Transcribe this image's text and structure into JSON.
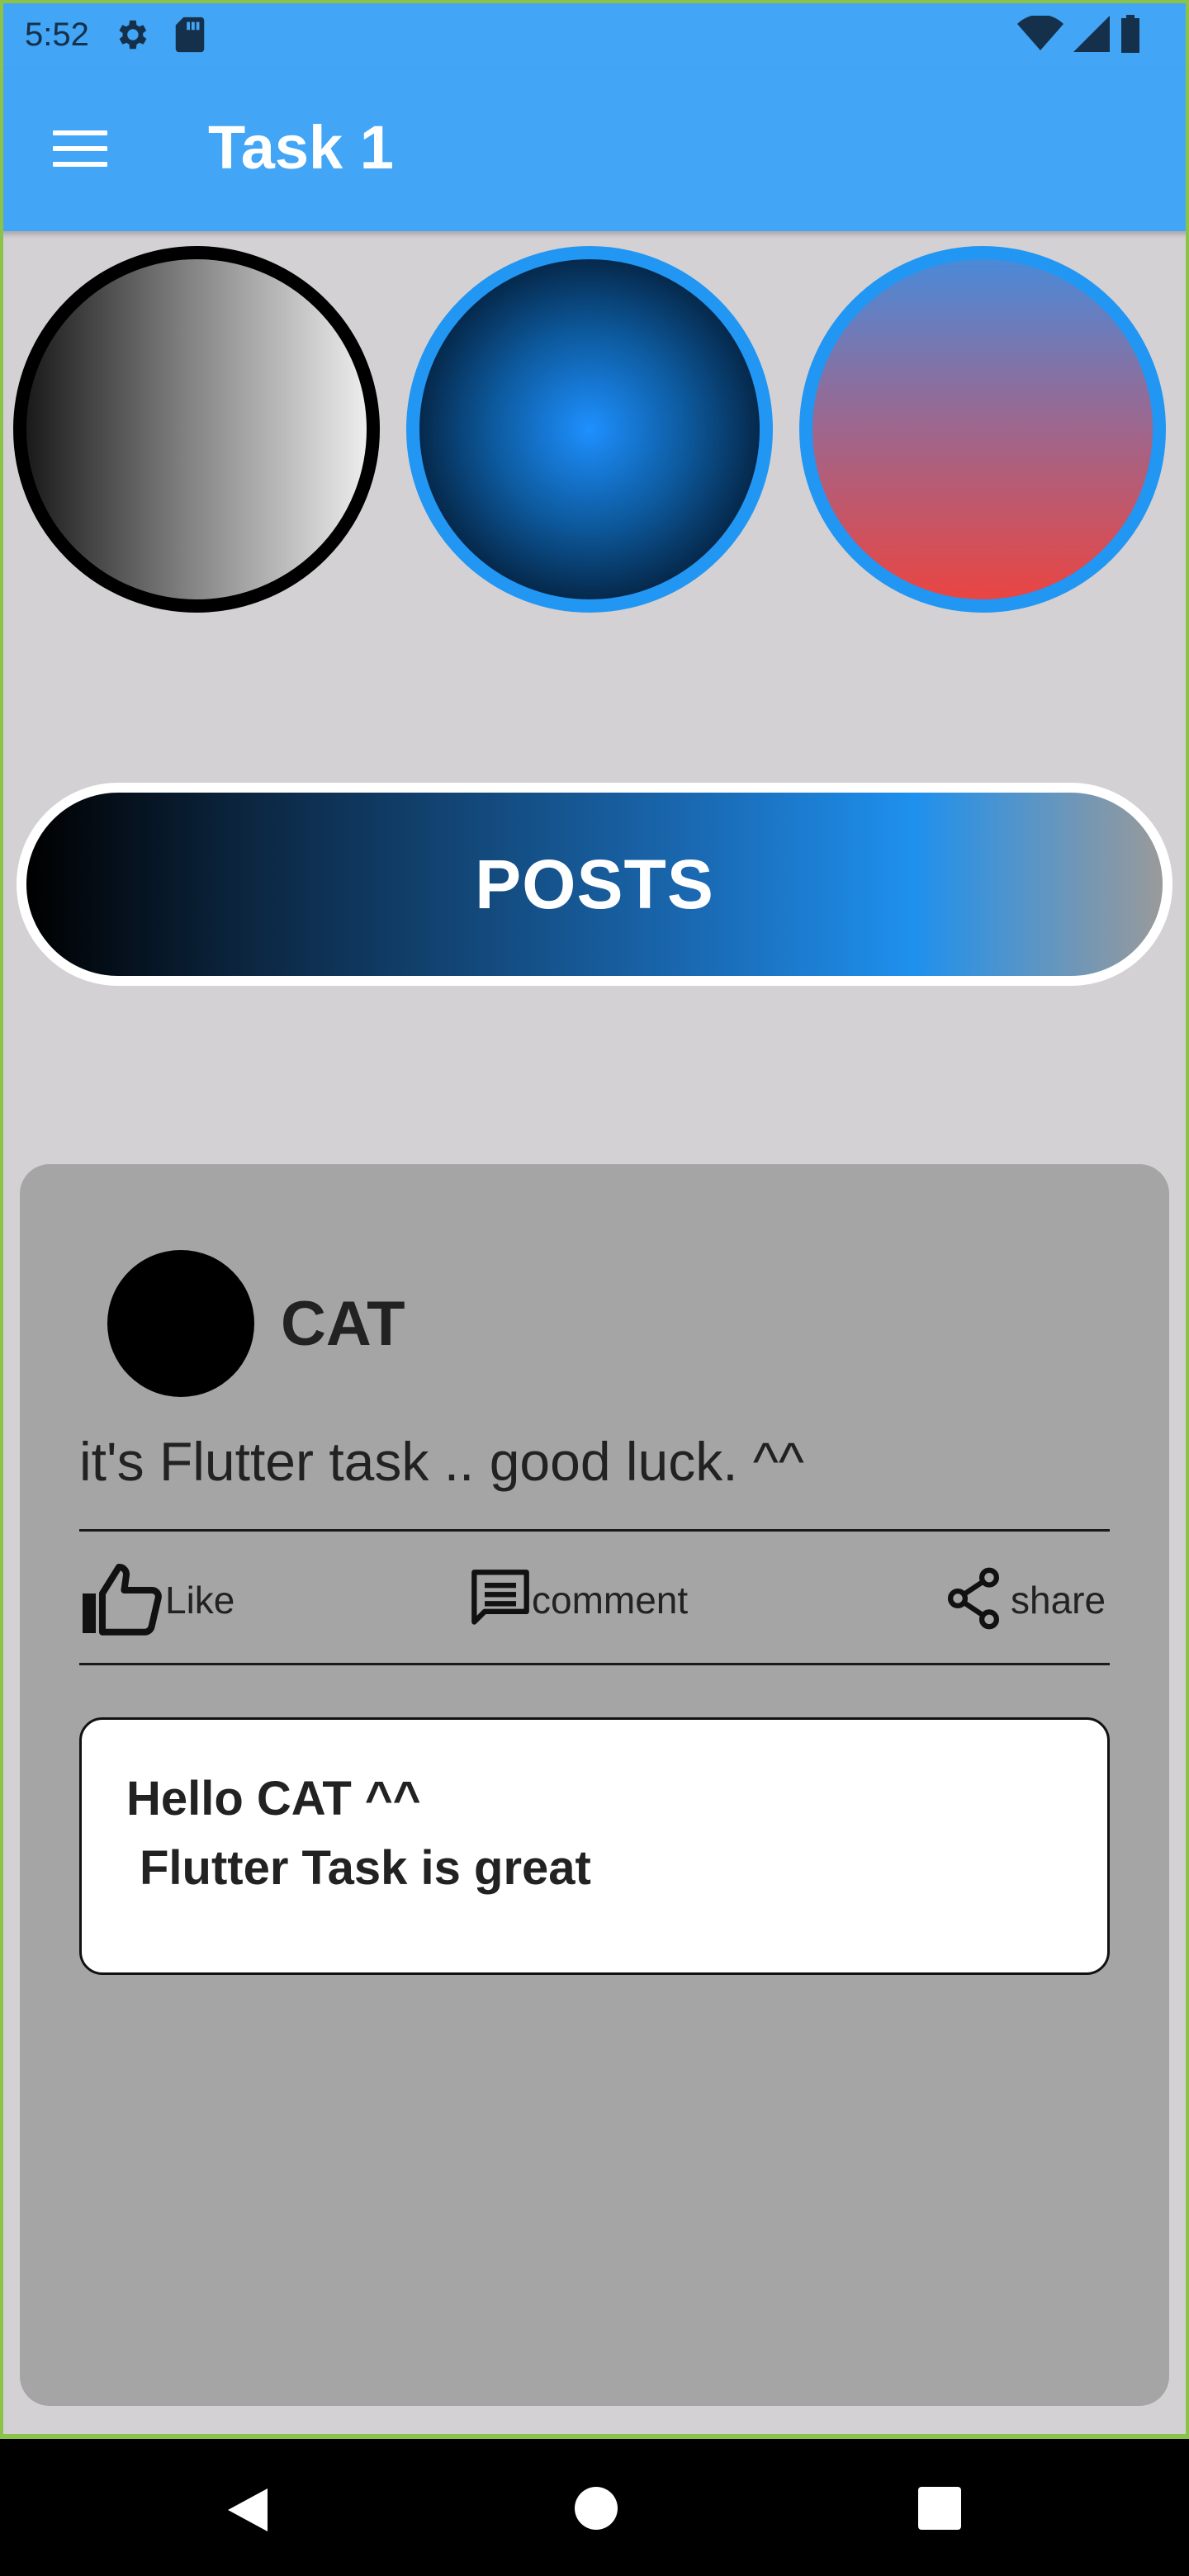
{
  "status_bar": {
    "time": "5:52",
    "left_icons": [
      "gear-icon",
      "sd-card-icon"
    ],
    "right_icons": [
      "wifi-icon",
      "signal-icon",
      "battery-icon"
    ]
  },
  "app_bar": {
    "title": "Task 1",
    "menu_icon": "hamburger-menu-icon",
    "color": "#42a5f5"
  },
  "circles": [
    {
      "name": "gray-gradient-circle",
      "border": "#000000"
    },
    {
      "name": "blue-radial-circle",
      "border": "#2196f3"
    },
    {
      "name": "blue-red-gradient-circle",
      "border": "#2196f3"
    }
  ],
  "posts_button": {
    "label": "POSTS"
  },
  "post": {
    "author": "CAT",
    "text": "it's Flutter task .. good luck. ^^",
    "actions": [
      {
        "icon": "thumbs-up-icon",
        "label": "Like"
      },
      {
        "icon": "comment-icon",
        "label": "comment"
      },
      {
        "icon": "share-icon",
        "label": "share"
      }
    ],
    "comment": {
      "line1": "Hello CAT ^^",
      "line2": "Flutter Task is great"
    }
  },
  "nav_bar": {
    "buttons": [
      "back-icon",
      "home-icon",
      "recents-icon"
    ]
  }
}
